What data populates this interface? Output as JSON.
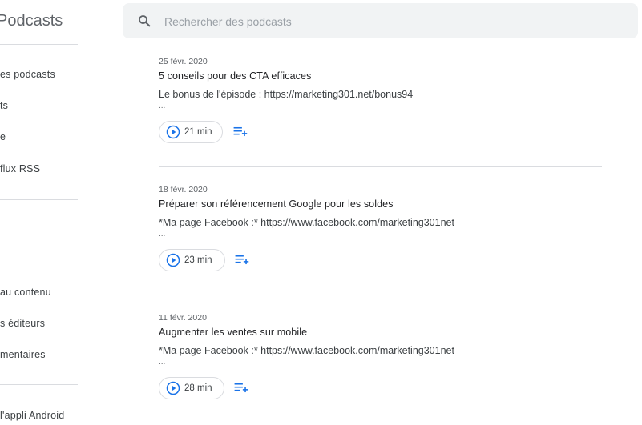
{
  "app": {
    "title": "Podcasts"
  },
  "sidebar": {
    "items": [
      {
        "label": "es podcasts"
      },
      {
        "label": "ts"
      },
      {
        "label": "e"
      },
      {
        "label": "flux RSS"
      },
      {
        "label": "au contenu"
      },
      {
        "label": "s éditeurs"
      },
      {
        "label": "mentaires"
      },
      {
        "label": "l'appli Android"
      }
    ]
  },
  "search": {
    "placeholder": "Rechercher des podcasts",
    "value": ""
  },
  "episodes": [
    {
      "date": "25 févr. 2020",
      "title": "5 conseils pour des CTA efficaces",
      "description": "Le bonus de l'épisode : https://marketing301.net/bonus94",
      "ellipsis": "...",
      "duration": "21 min"
    },
    {
      "date": "18 févr. 2020",
      "title": "Préparer son référencement Google pour les soldes",
      "description": "*Ma page Facebook :* https://www.facebook.com/marketing301net",
      "ellipsis": "...",
      "duration": "23 min"
    },
    {
      "date": "11 févr. 2020",
      "title": "Augmenter les ventes sur mobile",
      "description": "*Ma page Facebook :* https://www.facebook.com/marketing301net",
      "ellipsis": "...",
      "duration": "28 min"
    }
  ],
  "colors": {
    "accent": "#1a73e8",
    "divider": "#dadce0",
    "search_bg": "#f1f3f4"
  },
  "icons": {
    "search": "search-icon",
    "play": "play-circle-icon",
    "queue": "add-to-queue-icon"
  }
}
